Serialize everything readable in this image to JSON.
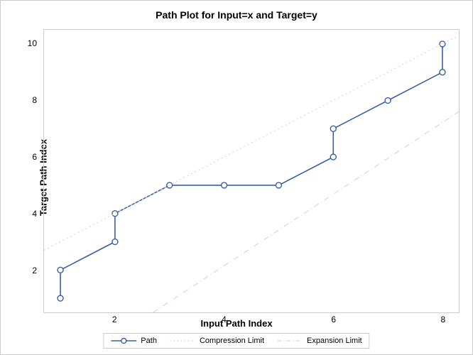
{
  "chart_data": {
    "type": "line",
    "title": "Path Plot for Input=x and Target=y",
    "xlabel": "Input Path Index",
    "ylabel": "Target Path Index",
    "xlim": [
      0.7,
      8.3
    ],
    "ylim": [
      0.5,
      10.5
    ],
    "xticks": [
      2,
      4,
      6,
      8
    ],
    "yticks": [
      2,
      4,
      6,
      8,
      10
    ],
    "series": [
      {
        "name": "Path",
        "style": "solid-markers",
        "color": "#3a5fa5",
        "points": [
          {
            "x": 1,
            "y": 1
          },
          {
            "x": 1,
            "y": 2
          },
          {
            "x": 2,
            "y": 3
          },
          {
            "x": 2,
            "y": 4
          },
          {
            "x": 3,
            "y": 5
          },
          {
            "x": 4,
            "y": 5
          },
          {
            "x": 5,
            "y": 5
          },
          {
            "x": 6,
            "y": 6
          },
          {
            "x": 6,
            "y": 7
          },
          {
            "x": 7,
            "y": 8
          },
          {
            "x": 8,
            "y": 9
          },
          {
            "x": 8,
            "y": 10
          }
        ]
      },
      {
        "name": "Compression Limit",
        "style": "dotted",
        "color": "#d8d8d8",
        "points": [
          {
            "x": 0.7,
            "y": 2.7
          },
          {
            "x": 8.3,
            "y": 10.3
          }
        ]
      },
      {
        "name": "Expansion Limit",
        "style": "dash-dot",
        "color": "#d8d8d8",
        "points": [
          {
            "x": 2.7,
            "y": 0.5
          },
          {
            "x": 8.3,
            "y": 7.6
          }
        ]
      }
    ],
    "legend": [
      "Path",
      "Compression Limit",
      "Expansion Limit"
    ]
  }
}
